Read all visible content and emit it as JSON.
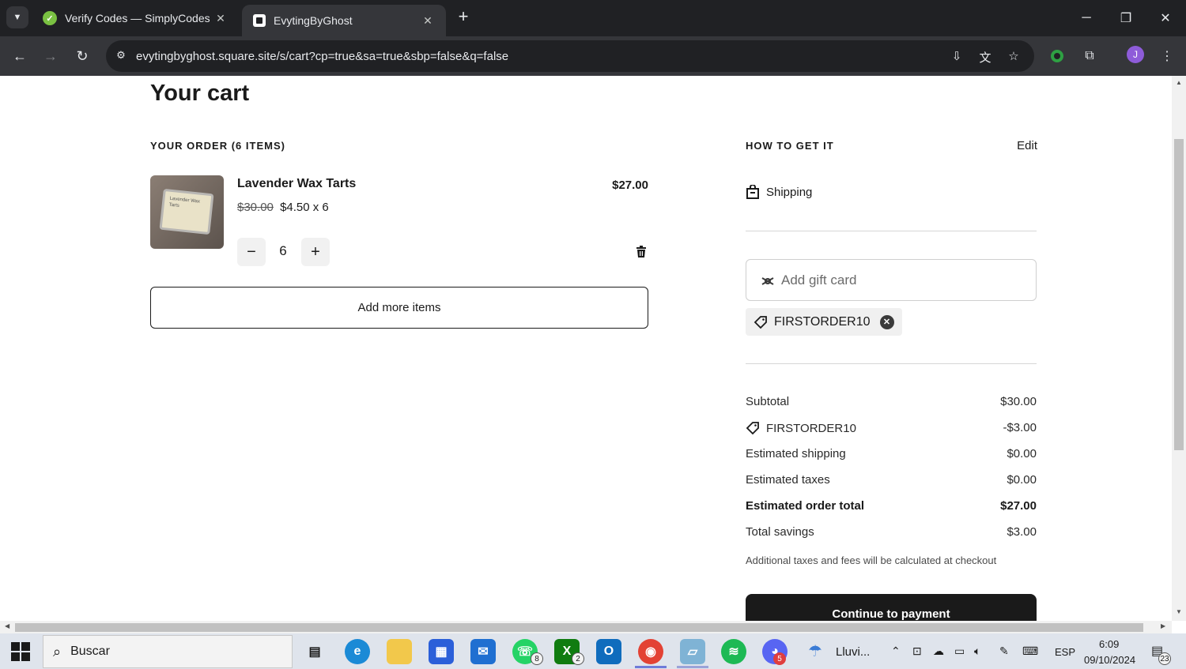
{
  "browser": {
    "tabs": [
      {
        "title": "Verify Codes — SimplyCodes",
        "favicon": "simplycodes-check-icon",
        "active": false
      },
      {
        "title": "EvytingByGhost",
        "favicon": "square-store-icon",
        "active": true
      }
    ],
    "url": "evytingbyghost.square.site/s/cart?cp=true&sa=true&sbp=false&q=false",
    "profile_initial": "J"
  },
  "cart": {
    "title": "Your cart",
    "order_label": "YOUR ORDER (6 ITEMS)",
    "item": {
      "name": "Lavender Wax Tarts",
      "original_price": "$30.00",
      "unit_price": "$4.50 x 6",
      "line_total": "$27.00",
      "quantity": "6",
      "image_text": "Lavender Wax Tarts"
    },
    "add_more_label": "Add more items"
  },
  "fulfillment": {
    "label": "HOW TO GET IT",
    "edit_label": "Edit",
    "method": "Shipping"
  },
  "gift_card": {
    "placeholder": "Add gift card"
  },
  "promo": {
    "code": "FIRSTORDER10"
  },
  "summary": {
    "rows": [
      {
        "label": "Subtotal",
        "value": "$30.00"
      },
      {
        "label": "FIRSTORDER10",
        "value": "-$3.00"
      },
      {
        "label": "Estimated shipping",
        "value": "$0.00"
      },
      {
        "label": "Estimated taxes",
        "value": "$0.00"
      },
      {
        "label": "Estimated order total",
        "value": "$27.00"
      },
      {
        "label": "Total savings",
        "value": "$3.00"
      }
    ],
    "note": "Additional taxes and fees will be calculated at checkout",
    "pay_label": "Continue to payment"
  },
  "taskbar": {
    "search_label": "Buscar",
    "weather": "Lluvi...",
    "language": "ESP",
    "time": "6:09",
    "date": "09/10/2024",
    "notifications": "23",
    "whatsapp_badge": "8",
    "xbox_badge": "2",
    "discord_badge": "5"
  },
  "colors": {
    "accent_dark": "#1a1a1a",
    "chrome_dark": "#202124",
    "chrome_toolbar": "#35363a",
    "taskbar_bg": "#dfe4ec"
  }
}
